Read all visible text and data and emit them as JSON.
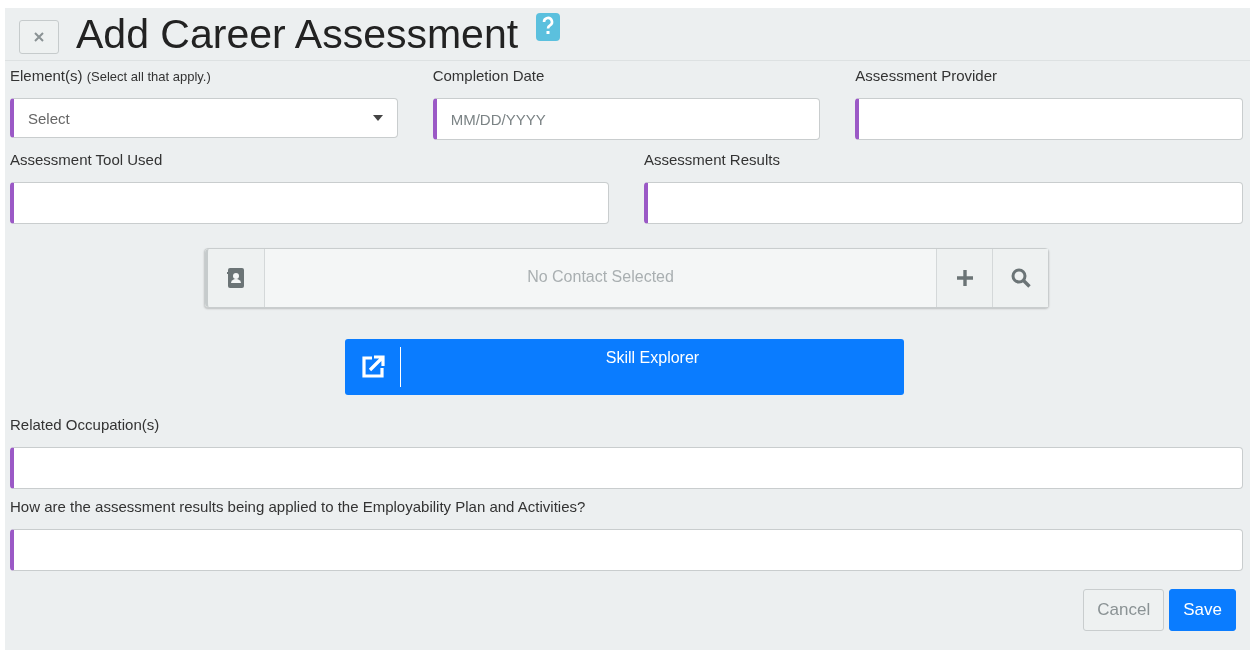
{
  "title": "Add Career Assessment",
  "rows": [
    {
      "fields": [
        {
          "label": "Element(s)",
          "note": "(Select all that apply.)",
          "kind": "select",
          "placeholder": "Select"
        },
        {
          "label": "Completion Date",
          "kind": "text",
          "placeholder": "MM/DD/YYYY"
        },
        {
          "label": "Assessment Provider",
          "kind": "text"
        }
      ]
    },
    {
      "fields": [
        {
          "label": "Assessment Tool Used",
          "kind": "text"
        },
        {
          "label": "Assessment Results",
          "kind": "text"
        }
      ]
    }
  ],
  "contact": {
    "placeholder": "No Contact Selected"
  },
  "skill_button": {
    "label": "Skill Explorer"
  },
  "wide_fields": [
    {
      "label": "Related Occupation(s)",
      "kind": "text"
    },
    {
      "label": "How are the assessment results being applied to the Employability Plan and Activities?",
      "kind": "text"
    }
  ],
  "buttons": [
    {
      "label": "Cancel",
      "kind": "secondary"
    },
    {
      "label": "Save",
      "kind": "primary"
    }
  ]
}
